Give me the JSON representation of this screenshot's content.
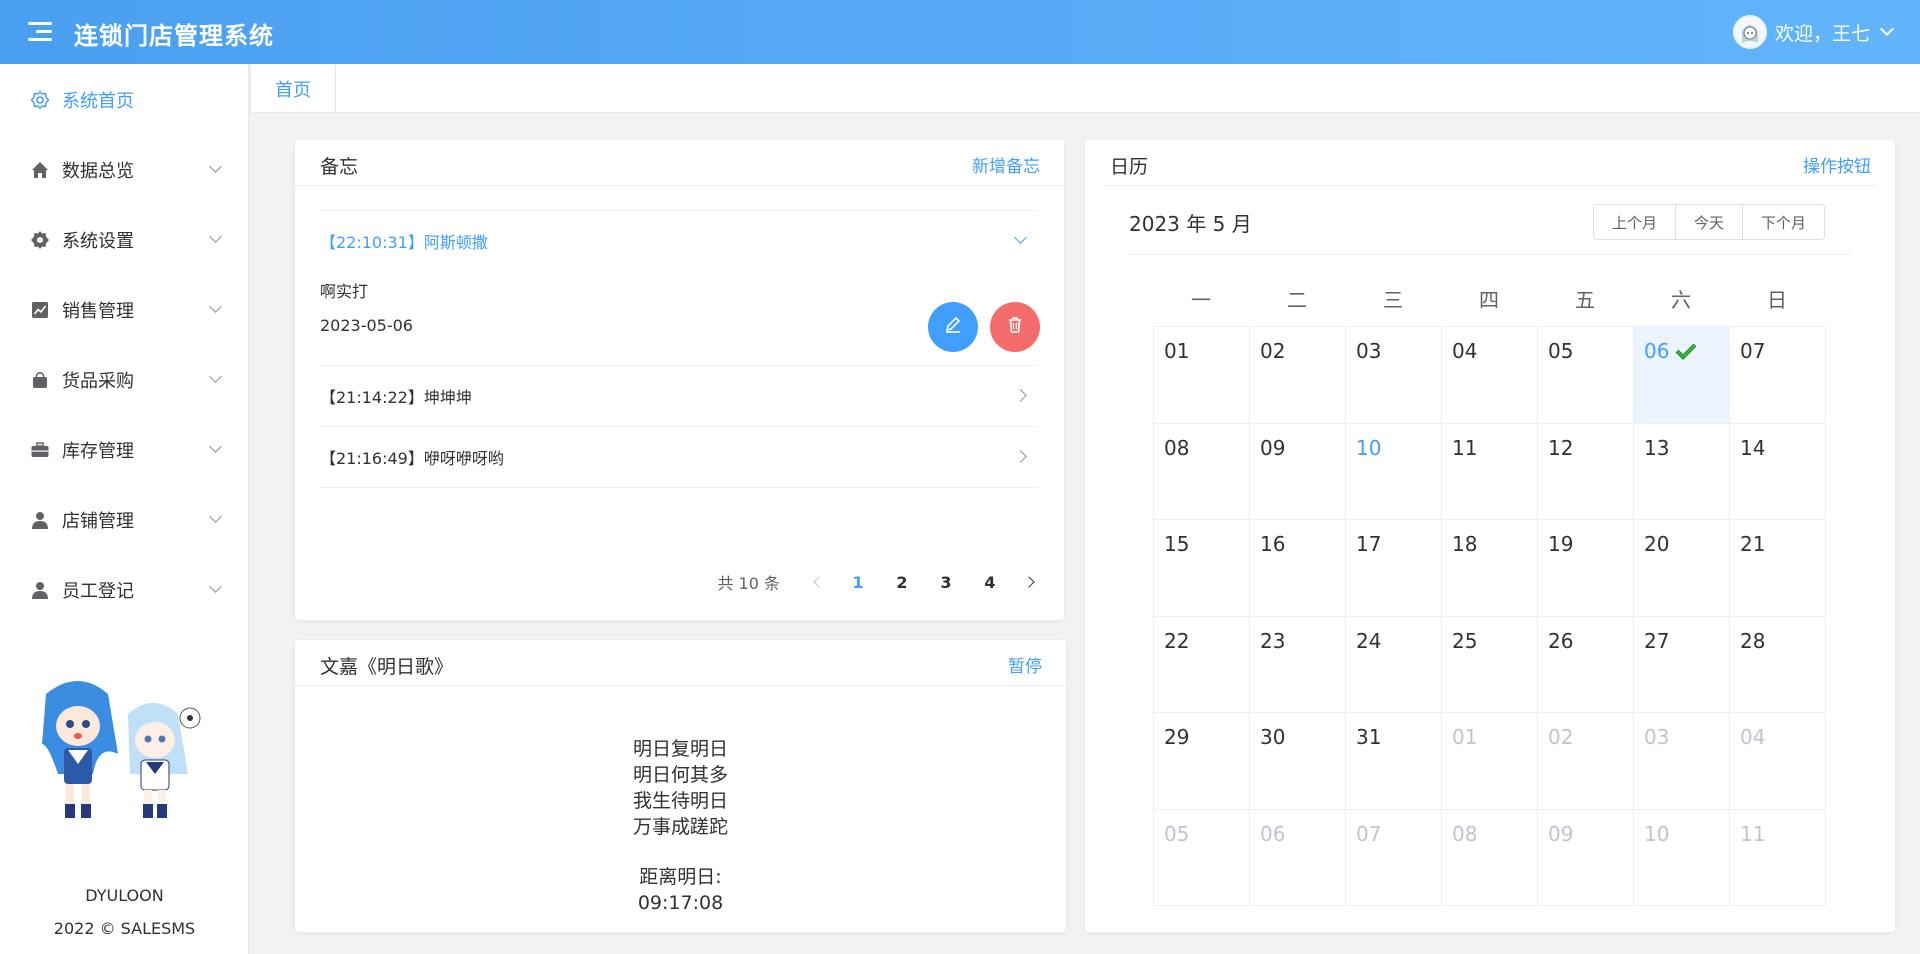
{
  "header": {
    "title": "连锁门店管理系统",
    "welcome": "欢迎，王七"
  },
  "sidebar": {
    "items": [
      {
        "label": "系统首页",
        "icon": "gear-outline-icon",
        "active": true
      },
      {
        "label": "数据总览",
        "icon": "home-icon"
      },
      {
        "label": "系统设置",
        "icon": "gear-icon"
      },
      {
        "label": "销售管理",
        "icon": "chart-icon"
      },
      {
        "label": "货品采购",
        "icon": "bag-icon"
      },
      {
        "label": "库存管理",
        "icon": "briefcase-icon"
      },
      {
        "label": "店铺管理",
        "icon": "user-icon"
      },
      {
        "label": "员工登记",
        "icon": "user-icon"
      }
    ],
    "footer_name": "DYULOON",
    "footer_copy": "2022 © SALESMS"
  },
  "tabs": {
    "home": "首页"
  },
  "memo": {
    "title": "备忘",
    "add_label": "新增备忘",
    "items": [
      {
        "title": "【22:10:31】阿斯顿撒",
        "content": "啊实打",
        "date": "2023-05-06",
        "expanded": true
      },
      {
        "title": "【21:14:22】坤坤坤"
      },
      {
        "title": "【21:16:49】咿呀咿呀哟"
      }
    ],
    "pagination": {
      "total": "共 10 条",
      "pages": [
        "1",
        "2",
        "3",
        "4"
      ],
      "current": "1"
    }
  },
  "poem": {
    "title": "文嘉《明日歌》",
    "pause_label": "暂停",
    "lines": [
      "明日复明日",
      "明日何其多",
      "我生待明日",
      "万事成蹉跎"
    ],
    "countdown_label": "距离明日:",
    "countdown_time": "09:17:08"
  },
  "calendar": {
    "title": "日历",
    "action_label": "操作按钮",
    "month_label": "2023 年 5 月",
    "buttons": [
      "上个月",
      "今天",
      "下个月"
    ],
    "weekdays": [
      "一",
      "二",
      "三",
      "四",
      "五",
      "六",
      "日"
    ],
    "days": [
      {
        "d": "01"
      },
      {
        "d": "02"
      },
      {
        "d": "03"
      },
      {
        "d": "04"
      },
      {
        "d": "05"
      },
      {
        "d": "06",
        "selected": true,
        "checked": true
      },
      {
        "d": "07"
      },
      {
        "d": "08"
      },
      {
        "d": "09"
      },
      {
        "d": "10",
        "today": true
      },
      {
        "d": "11"
      },
      {
        "d": "12"
      },
      {
        "d": "13"
      },
      {
        "d": "14"
      },
      {
        "d": "15"
      },
      {
        "d": "16"
      },
      {
        "d": "17"
      },
      {
        "d": "18"
      },
      {
        "d": "19"
      },
      {
        "d": "20"
      },
      {
        "d": "21"
      },
      {
        "d": "22"
      },
      {
        "d": "23"
      },
      {
        "d": "24"
      },
      {
        "d": "25"
      },
      {
        "d": "26"
      },
      {
        "d": "27"
      },
      {
        "d": "28"
      },
      {
        "d": "29"
      },
      {
        "d": "30"
      },
      {
        "d": "31"
      },
      {
        "d": "01",
        "other": true
      },
      {
        "d": "02",
        "other": true
      },
      {
        "d": "03",
        "other": true
      },
      {
        "d": "04",
        "other": true
      },
      {
        "d": "05",
        "other": true
      },
      {
        "d": "06",
        "other": true
      },
      {
        "d": "07",
        "other": true
      },
      {
        "d": "08",
        "other": true
      },
      {
        "d": "09",
        "other": true
      },
      {
        "d": "10",
        "other": true
      },
      {
        "d": "11",
        "other": true
      }
    ]
  },
  "colors": {
    "primary": "#409eff",
    "danger": "#f56c6c",
    "header_bg": "#55a9f5"
  }
}
